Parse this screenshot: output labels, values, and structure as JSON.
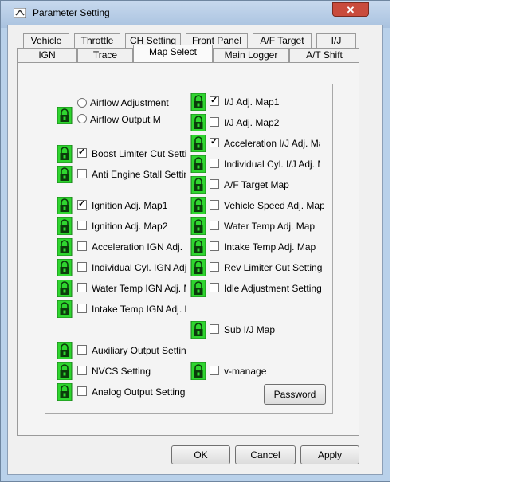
{
  "window": {
    "title": "Parameter Setting",
    "close_label": "✕"
  },
  "tabs_row1": [
    "Vehicle",
    "Throttle",
    "CH Setting",
    "Front Panel",
    "A/F Target",
    "I/J"
  ],
  "tabs_row2": [
    "IGN",
    "Trace",
    "Map Select",
    "Main Logger",
    "A/T Shift"
  ],
  "active_tab": "Map Select",
  "left": {
    "airflow_adjustment": "Airflow Adjustment",
    "airflow_output_map": "Airflow Output Map",
    "boost_limiter_cut": "Boost Limiter Cut Setting",
    "anti_engine_stall": "Anti Engine Stall Setting",
    "ignition_adj_map1": "Ignition Adj. Map1",
    "ignition_adj_map2": "Ignition Adj. Map2",
    "acceleration_ign_adj": "Acceleration IGN Adj. Map",
    "individual_cyl_ign": "Individual Cyl. IGN Adj. Map",
    "water_temp_ign": "Water Temp IGN Adj. Map",
    "intake_temp_ign": "Intake Temp IGN Adj. Map",
    "auxiliary_output": "Auxiliary Output Setting",
    "nvcs_setting": "NVCS Setting",
    "analog_output": "Analog Output Setting"
  },
  "right": {
    "ij_adj_map1": "I/J Adj. Map1",
    "ij_adj_map2": "I/J Adj. Map2",
    "acceleration_ij_adj": "Acceleration I/J Adj. Map",
    "individual_cyl_ij": "Individual Cyl. I/J Adj. Map",
    "af_target_map": "A/F Target Map",
    "vehicle_speed_adj": "Vehicle Speed Adj. Map",
    "water_temp_adj": "Water Temp Adj. Map",
    "intake_temp_adj": "Intake Temp Adj. Map",
    "rev_limiter_cut": "Rev Limiter Cut Setting",
    "idle_adjustment": "Idle Adjustment Setting",
    "sub_ij_map": "Sub I/J Map",
    "v_manage": "v-manage"
  },
  "checked": [
    "boost_limiter_cut",
    "ignition_adj_map1",
    "ij_adj_map1",
    "acceleration_ij_adj"
  ],
  "buttons": {
    "password": "Password",
    "ok": "OK",
    "cancel": "Cancel",
    "apply": "Apply"
  },
  "colors": {
    "lock_green": "#2fd52f",
    "title_bar": "#b9d1ea",
    "close_red": "#c94b3c"
  },
  "icons": {
    "lock": "padlock-icon"
  }
}
